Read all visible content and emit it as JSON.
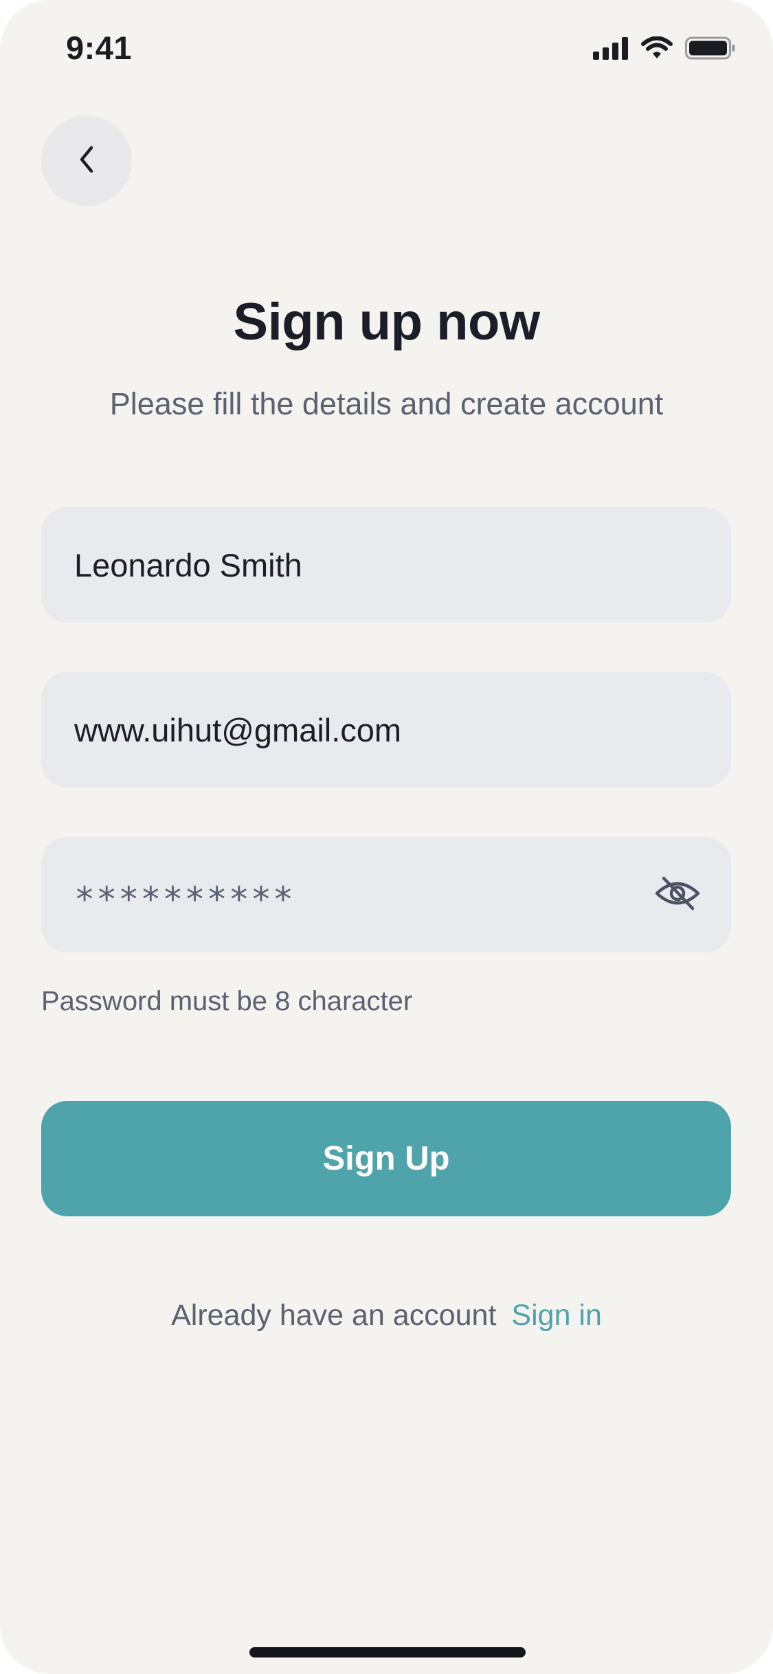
{
  "status_bar": {
    "time": "9:41"
  },
  "icons": {
    "back": "chevron-left-icon",
    "cellular": "cellular-signal-icon",
    "wifi": "wifi-icon",
    "battery": "battery-icon",
    "visibility": "eye-slash-icon"
  },
  "header": {
    "title": "Sign up now",
    "subtitle": "Please fill the details and create account"
  },
  "form": {
    "name_value": "Leonardo Smith",
    "email_value": "www.uihut@gmail.com",
    "password_mask": "**********",
    "password_helper": "Password must be 8 character"
  },
  "actions": {
    "signup_label": "Sign Up",
    "signin_prompt": "Already have an account",
    "signin_link": "Sign in"
  },
  "colors": {
    "background": "#f4f3f0",
    "field": "#e9eaee",
    "accent": "#4fa3ab",
    "text_primary": "#1b1e28",
    "text_secondary": "#5b6170"
  }
}
